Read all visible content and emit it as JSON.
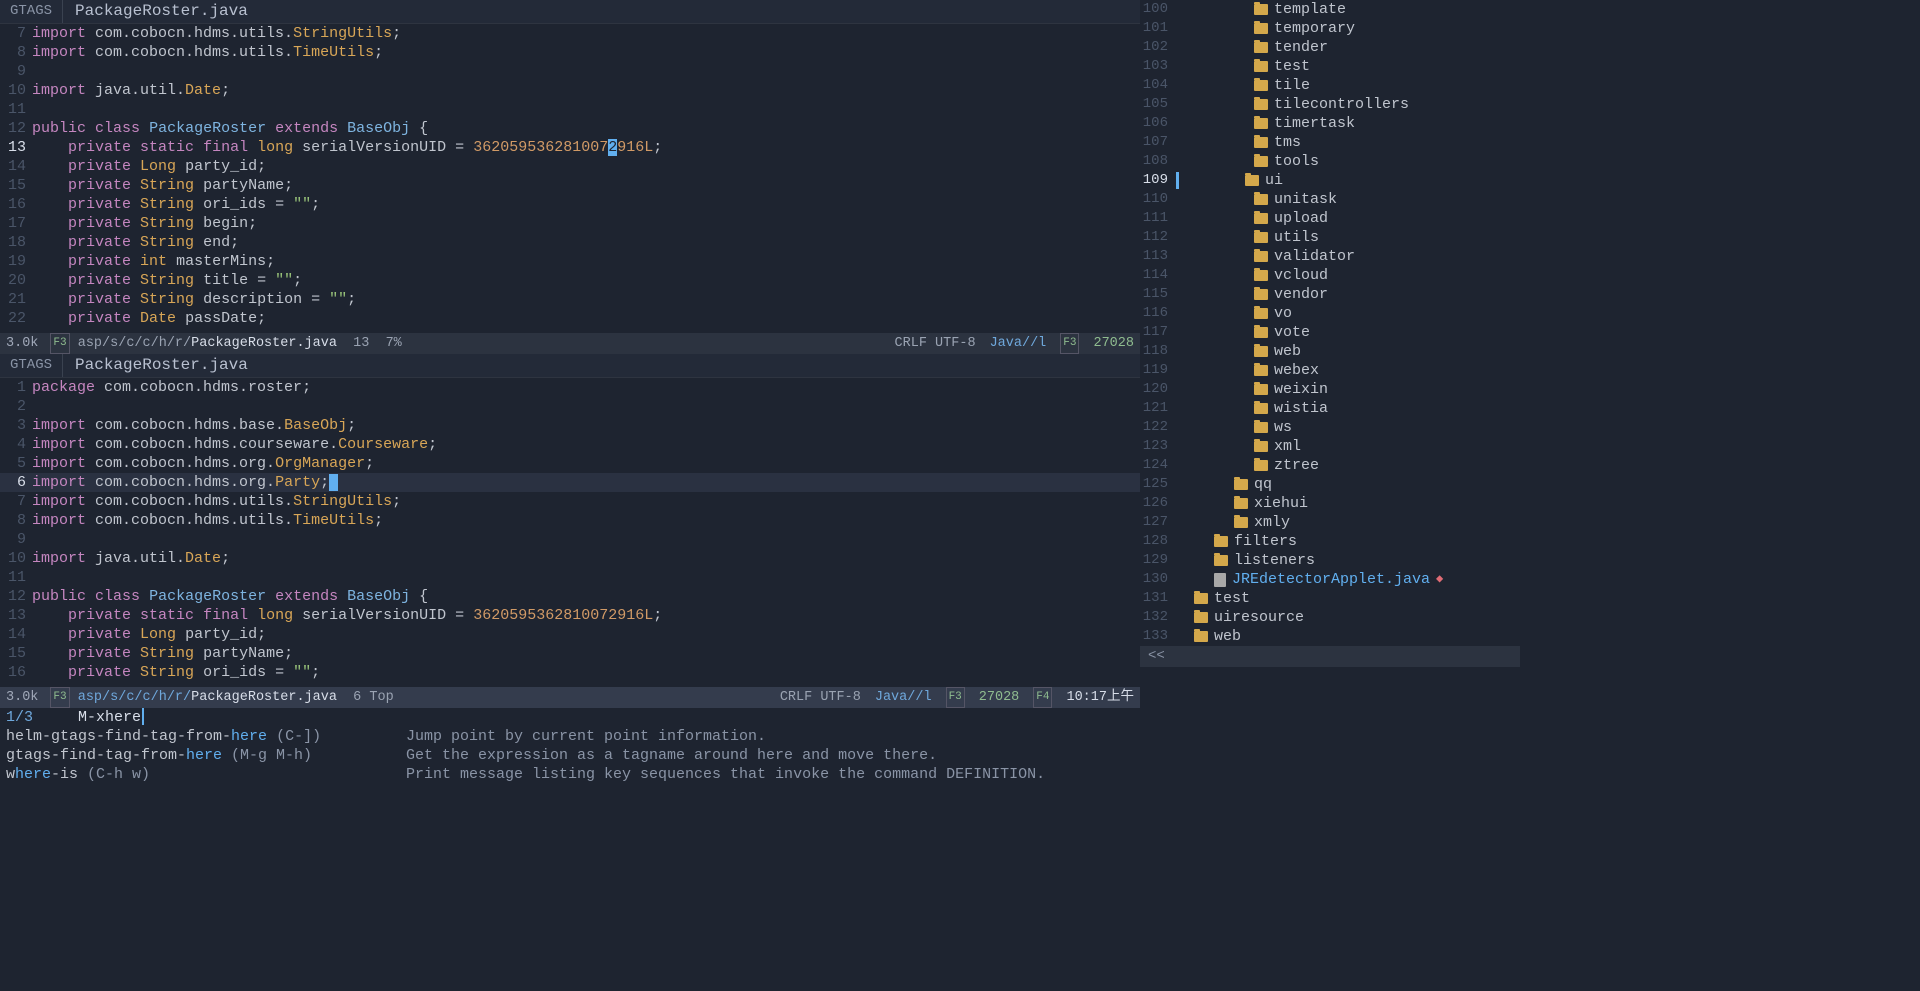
{
  "tabs": {
    "left_label": "GTAGS",
    "filename": "PackageRoster.java"
  },
  "pane1": {
    "lines": [
      {
        "n": 7,
        "tokens": [
          [
            "kw",
            "import"
          ],
          [
            "punct",
            " "
          ],
          [
            "pkgpart",
            "com.cobocn.hdms.utils."
          ],
          [
            "pkghl",
            "StringUtils"
          ],
          [
            "punct",
            ";"
          ]
        ]
      },
      {
        "n": 8,
        "tokens": [
          [
            "kw",
            "import"
          ],
          [
            "punct",
            " "
          ],
          [
            "pkgpart",
            "com.cobocn.hdms.utils."
          ],
          [
            "pkghl",
            "TimeUtils"
          ],
          [
            "punct",
            ";"
          ]
        ]
      },
      {
        "n": 9,
        "tokens": []
      },
      {
        "n": 10,
        "tokens": [
          [
            "kw",
            "import"
          ],
          [
            "punct",
            " "
          ],
          [
            "pkgpart",
            "java.util."
          ],
          [
            "pkghl",
            "Date"
          ],
          [
            "punct",
            ";"
          ]
        ]
      },
      {
        "n": 11,
        "tokens": []
      },
      {
        "n": 12,
        "tokens": [
          [
            "kw",
            "public"
          ],
          [
            "punct",
            " "
          ],
          [
            "kw",
            "class"
          ],
          [
            "punct",
            " "
          ],
          [
            "classname",
            "PackageRoster"
          ],
          [
            "punct",
            " "
          ],
          [
            "kw",
            "extends"
          ],
          [
            "punct",
            " "
          ],
          [
            "classname",
            "BaseObj"
          ],
          [
            "punct",
            " {"
          ]
        ]
      },
      {
        "n": 13,
        "current": true,
        "indent": "    ",
        "tokens": [
          [
            "kw",
            "private"
          ],
          [
            "punct",
            " "
          ],
          [
            "kw",
            "static"
          ],
          [
            "punct",
            " "
          ],
          [
            "kw",
            "final"
          ],
          [
            "punct",
            " "
          ],
          [
            "type",
            "long"
          ],
          [
            "punct",
            " "
          ],
          [
            "ident",
            "serialVersionUID"
          ],
          [
            "punct",
            " = "
          ],
          [
            "num-lit",
            "362059536281007"
          ],
          [
            "cursor-inline",
            "2"
          ],
          [
            "num-lit",
            "916L"
          ],
          [
            "punct",
            ";"
          ]
        ]
      },
      {
        "n": 14,
        "indent": "    ",
        "tokens": [
          [
            "kw",
            "private"
          ],
          [
            "punct",
            " "
          ],
          [
            "type",
            "Long"
          ],
          [
            "punct",
            " "
          ],
          [
            "field",
            "party_id"
          ],
          [
            "punct",
            ";"
          ]
        ]
      },
      {
        "n": 15,
        "indent": "    ",
        "tokens": [
          [
            "kw",
            "private"
          ],
          [
            "punct",
            " "
          ],
          [
            "type",
            "String"
          ],
          [
            "punct",
            " "
          ],
          [
            "field",
            "partyName"
          ],
          [
            "punct",
            ";"
          ]
        ]
      },
      {
        "n": 16,
        "indent": "    ",
        "tokens": [
          [
            "kw",
            "private"
          ],
          [
            "punct",
            " "
          ],
          [
            "type",
            "String"
          ],
          [
            "punct",
            " "
          ],
          [
            "field",
            "ori_ids"
          ],
          [
            "punct",
            " = "
          ],
          [
            "str",
            "\"\""
          ],
          [
            "punct",
            ";"
          ]
        ]
      },
      {
        "n": 17,
        "indent": "    ",
        "tokens": [
          [
            "kw",
            "private"
          ],
          [
            "punct",
            " "
          ],
          [
            "type",
            "String"
          ],
          [
            "punct",
            " "
          ],
          [
            "field",
            "begin"
          ],
          [
            "punct",
            ";"
          ]
        ]
      },
      {
        "n": 18,
        "indent": "    ",
        "tokens": [
          [
            "kw",
            "private"
          ],
          [
            "punct",
            " "
          ],
          [
            "type",
            "String"
          ],
          [
            "punct",
            " "
          ],
          [
            "field",
            "end"
          ],
          [
            "punct",
            ";"
          ]
        ]
      },
      {
        "n": 19,
        "indent": "    ",
        "tokens": [
          [
            "kw",
            "private"
          ],
          [
            "punct",
            " "
          ],
          [
            "type",
            "int"
          ],
          [
            "punct",
            " "
          ],
          [
            "field",
            "masterMins"
          ],
          [
            "punct",
            ";"
          ]
        ]
      },
      {
        "n": 20,
        "indent": "    ",
        "tokens": [
          [
            "kw",
            "private"
          ],
          [
            "punct",
            " "
          ],
          [
            "type",
            "String"
          ],
          [
            "punct",
            " "
          ],
          [
            "field",
            "title"
          ],
          [
            "punct",
            " = "
          ],
          [
            "str",
            "\"\""
          ],
          [
            "punct",
            ";"
          ]
        ]
      },
      {
        "n": 21,
        "indent": "    ",
        "tokens": [
          [
            "kw",
            "private"
          ],
          [
            "punct",
            " "
          ],
          [
            "type",
            "String"
          ],
          [
            "punct",
            " "
          ],
          [
            "field",
            "description"
          ],
          [
            "punct",
            " = "
          ],
          [
            "str",
            "\"\""
          ],
          [
            "punct",
            ";"
          ]
        ]
      },
      {
        "n": 22,
        "indent": "    ",
        "tokens": [
          [
            "kw",
            "private"
          ],
          [
            "punct",
            " "
          ],
          [
            "type",
            "Date"
          ],
          [
            "punct",
            " "
          ],
          [
            "field",
            "passDate"
          ],
          [
            "punct",
            ";"
          ]
        ]
      }
    ],
    "modeline": {
      "size": "3.0k",
      "path_prefix": "asp/s/c/c/h/r/",
      "basename": "PackageRoster.java",
      "line": "13",
      "pct": "7%",
      "encoding": "CRLF UTF-8",
      "mode": "Java//l",
      "right_num": "27028"
    }
  },
  "pane2": {
    "lines": [
      {
        "n": 1,
        "tokens": [
          [
            "kw",
            "package"
          ],
          [
            "punct",
            " "
          ],
          [
            "pkgpart",
            "com.cobocn.hdms.roster"
          ],
          [
            "punct",
            ";"
          ]
        ]
      },
      {
        "n": 2,
        "tokens": []
      },
      {
        "n": 3,
        "tokens": [
          [
            "kw",
            "import"
          ],
          [
            "punct",
            " "
          ],
          [
            "pkgpart",
            "com.cobocn.hdms.base."
          ],
          [
            "pkghl",
            "BaseObj"
          ],
          [
            "punct",
            ";"
          ]
        ]
      },
      {
        "n": 4,
        "tokens": [
          [
            "kw",
            "import"
          ],
          [
            "punct",
            " "
          ],
          [
            "pkgpart",
            "com.cobocn.hdms.courseware."
          ],
          [
            "pkghl",
            "Courseware"
          ],
          [
            "punct",
            ";"
          ]
        ]
      },
      {
        "n": 5,
        "tokens": [
          [
            "kw",
            "import"
          ],
          [
            "punct",
            " "
          ],
          [
            "pkgpart",
            "com.cobocn.hdms.org."
          ],
          [
            "pkghl",
            "OrgManager"
          ],
          [
            "punct",
            ";"
          ]
        ]
      },
      {
        "n": 6,
        "hl": true,
        "current": true,
        "tokens": [
          [
            "kw",
            "import"
          ],
          [
            "punct",
            " "
          ],
          [
            "pkgpart",
            "com.cobocn.hdms.org."
          ],
          [
            "pkghl",
            "Party"
          ],
          [
            "punct",
            ";"
          ],
          [
            "cursor-inline",
            " "
          ]
        ]
      },
      {
        "n": 7,
        "tokens": [
          [
            "kw",
            "import"
          ],
          [
            "punct",
            " "
          ],
          [
            "pkgpart",
            "com.cobocn.hdms.utils."
          ],
          [
            "pkghl",
            "StringUtils"
          ],
          [
            "punct",
            ";"
          ]
        ]
      },
      {
        "n": 8,
        "tokens": [
          [
            "kw",
            "import"
          ],
          [
            "punct",
            " "
          ],
          [
            "pkgpart",
            "com.cobocn.hdms.utils."
          ],
          [
            "pkghl",
            "TimeUtils"
          ],
          [
            "punct",
            ";"
          ]
        ]
      },
      {
        "n": 9,
        "tokens": []
      },
      {
        "n": 10,
        "tokens": [
          [
            "kw",
            "import"
          ],
          [
            "punct",
            " "
          ],
          [
            "pkgpart",
            "java.util."
          ],
          [
            "pkghl",
            "Date"
          ],
          [
            "punct",
            ";"
          ]
        ]
      },
      {
        "n": 11,
        "tokens": []
      },
      {
        "n": 12,
        "tokens": [
          [
            "kw",
            "public"
          ],
          [
            "punct",
            " "
          ],
          [
            "kw",
            "class"
          ],
          [
            "punct",
            " "
          ],
          [
            "classname",
            "PackageRoster"
          ],
          [
            "punct",
            " "
          ],
          [
            "kw",
            "extends"
          ],
          [
            "punct",
            " "
          ],
          [
            "classname",
            "BaseObj"
          ],
          [
            "punct",
            " {"
          ]
        ]
      },
      {
        "n": 13,
        "indent": "    ",
        "tokens": [
          [
            "kw",
            "private"
          ],
          [
            "punct",
            " "
          ],
          [
            "kw",
            "static"
          ],
          [
            "punct",
            " "
          ],
          [
            "kw",
            "final"
          ],
          [
            "punct",
            " "
          ],
          [
            "type",
            "long"
          ],
          [
            "punct",
            " "
          ],
          [
            "ident",
            "serialVersionUID"
          ],
          [
            "punct",
            " = "
          ],
          [
            "num-lit",
            "3620595362810072916L"
          ],
          [
            "punct",
            ";"
          ]
        ]
      },
      {
        "n": 14,
        "indent": "    ",
        "tokens": [
          [
            "kw",
            "private"
          ],
          [
            "punct",
            " "
          ],
          [
            "type",
            "Long"
          ],
          [
            "punct",
            " "
          ],
          [
            "field",
            "party_id"
          ],
          [
            "punct",
            ";"
          ]
        ]
      },
      {
        "n": 15,
        "indent": "    ",
        "tokens": [
          [
            "kw",
            "private"
          ],
          [
            "punct",
            " "
          ],
          [
            "type",
            "String"
          ],
          [
            "punct",
            " "
          ],
          [
            "field",
            "partyName"
          ],
          [
            "punct",
            ";"
          ]
        ]
      },
      {
        "n": 16,
        "indent": "    ",
        "tokens": [
          [
            "kw",
            "private"
          ],
          [
            "punct",
            " "
          ],
          [
            "type",
            "String"
          ],
          [
            "punct",
            " "
          ],
          [
            "field",
            "ori_ids"
          ],
          [
            "punct",
            " = "
          ],
          [
            "str",
            "\"\""
          ],
          [
            "punct",
            ";"
          ]
        ]
      }
    ],
    "modeline": {
      "size": "3.0k",
      "path_prefix": "asp/s/c/c/h/r/",
      "basename": "PackageRoster.java",
      "line": "6",
      "pct": "Top",
      "encoding": "CRLF UTF-8",
      "mode": "Java//l",
      "right_num": "27028",
      "time": "10:17上午"
    }
  },
  "minibuffer": {
    "count": "1/3",
    "prompt": "M-x ",
    "input": "here",
    "candidates": [
      {
        "pre": "helm-gtags-find-tag-from-",
        "match": "here",
        "key": " (C-])",
        "desc": "Jump point by current point information."
      },
      {
        "pre": "gtags-find-tag-from-",
        "match": "here",
        "key": " (M-g M-h)",
        "desc": "Get the expression as a tagname around here and move there."
      },
      {
        "pre": "w",
        "match": "here",
        "post": "-is",
        "key": " (C-h w)",
        "desc": "Print message listing key sequences that invoke the command DEFINITION."
      }
    ]
  },
  "tree": {
    "items": [
      {
        "n": 100,
        "name": "template",
        "indent": 3
      },
      {
        "n": 101,
        "name": "temporary",
        "indent": 3
      },
      {
        "n": 102,
        "name": "tender",
        "indent": 3
      },
      {
        "n": 103,
        "name": "test",
        "indent": 3
      },
      {
        "n": 104,
        "name": "tile",
        "indent": 3
      },
      {
        "n": 105,
        "name": "tilecontrollers",
        "indent": 3
      },
      {
        "n": 106,
        "name": "timertask",
        "indent": 3
      },
      {
        "n": 107,
        "name": "tms",
        "indent": 3
      },
      {
        "n": 108,
        "name": "tools",
        "indent": 3
      },
      {
        "n": 109,
        "name": "ui",
        "indent": 3,
        "current": true
      },
      {
        "n": 110,
        "name": "unitask",
        "indent": 3
      },
      {
        "n": 111,
        "name": "upload",
        "indent": 3
      },
      {
        "n": 112,
        "name": "utils",
        "indent": 3
      },
      {
        "n": 113,
        "name": "validator",
        "indent": 3
      },
      {
        "n": 114,
        "name": "vcloud",
        "indent": 3
      },
      {
        "n": 115,
        "name": "vendor",
        "indent": 3
      },
      {
        "n": 116,
        "name": "vo",
        "indent": 3
      },
      {
        "n": 117,
        "name": "vote",
        "indent": 3
      },
      {
        "n": 118,
        "name": "web",
        "indent": 3
      },
      {
        "n": 119,
        "name": "webex",
        "indent": 3
      },
      {
        "n": 120,
        "name": "weixin",
        "indent": 3
      },
      {
        "n": 121,
        "name": "wistia",
        "indent": 3
      },
      {
        "n": 122,
        "name": "ws",
        "indent": 3
      },
      {
        "n": 123,
        "name": "xml",
        "indent": 3
      },
      {
        "n": 124,
        "name": "ztree",
        "indent": 3
      },
      {
        "n": 125,
        "name": "qq",
        "indent": 2
      },
      {
        "n": 126,
        "name": "xiehui",
        "indent": 2
      },
      {
        "n": 127,
        "name": "xmly",
        "indent": 2
      },
      {
        "n": 128,
        "name": "filters",
        "indent": 1
      },
      {
        "n": 129,
        "name": "listeners",
        "indent": 1
      },
      {
        "n": 130,
        "name": "JREdetectorApplet.java",
        "indent": 1,
        "file": true,
        "hl": true,
        "diamond": true
      },
      {
        "n": 131,
        "name": "test",
        "indent": 0
      },
      {
        "n": 132,
        "name": "uiresource",
        "indent": 0
      },
      {
        "n": 133,
        "name": "web",
        "indent": 0
      }
    ],
    "footer": "<<"
  }
}
